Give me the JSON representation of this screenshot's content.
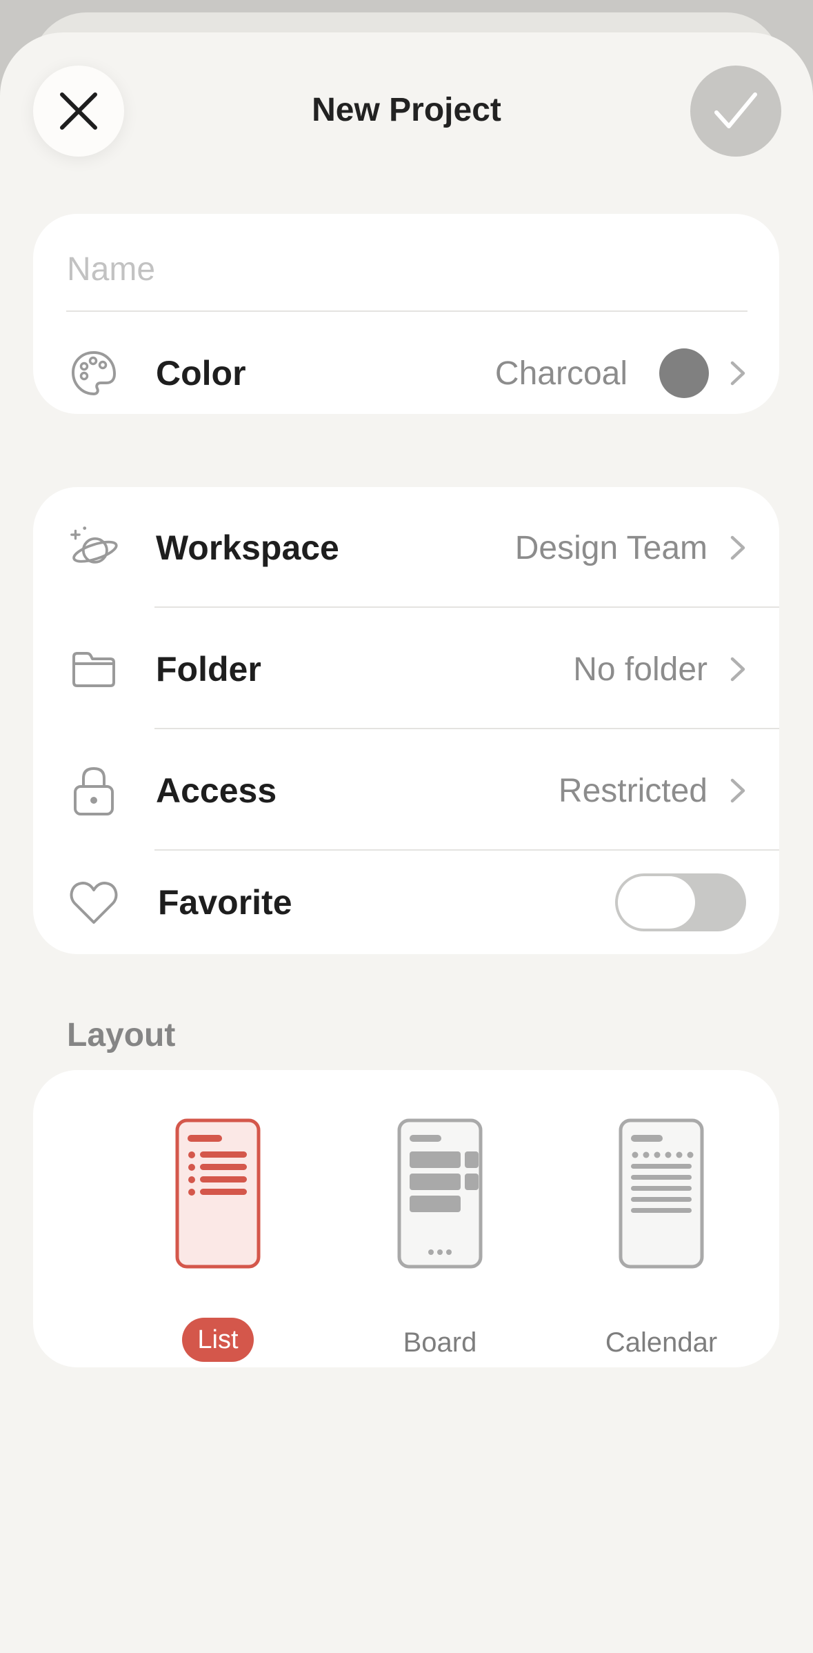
{
  "header": {
    "title": "New Project",
    "close_icon": "x-icon",
    "confirm_icon": "checkmark-icon"
  },
  "name_field": {
    "placeholder": "Name",
    "value": ""
  },
  "color_row": {
    "label": "Color",
    "value": "Charcoal",
    "swatch": "#808080",
    "icon": "palette-icon"
  },
  "settings": [
    {
      "label": "Workspace",
      "value": "Design Team",
      "icon": "planet-icon"
    },
    {
      "label": "Folder",
      "value": "No folder",
      "icon": "folder-icon"
    },
    {
      "label": "Access",
      "value": "Restricted",
      "icon": "lock-icon"
    }
  ],
  "favorite": {
    "label": "Favorite",
    "enabled": false,
    "icon": "heart-icon"
  },
  "layout": {
    "section_title": "Layout",
    "selected": "List",
    "options": [
      {
        "label": "List",
        "icon": "list-layout-icon"
      },
      {
        "label": "Board",
        "icon": "board-layout-icon"
      },
      {
        "label": "Calendar",
        "icon": "calendar-layout-icon"
      }
    ]
  },
  "colors": {
    "accent": "#d4574b",
    "accent_light": "#fbe8e6",
    "background": "#f5f4f1",
    "card": "#ffffff",
    "muted_text": "#8c8c8c",
    "icon_gray": "#a9a9a9"
  }
}
